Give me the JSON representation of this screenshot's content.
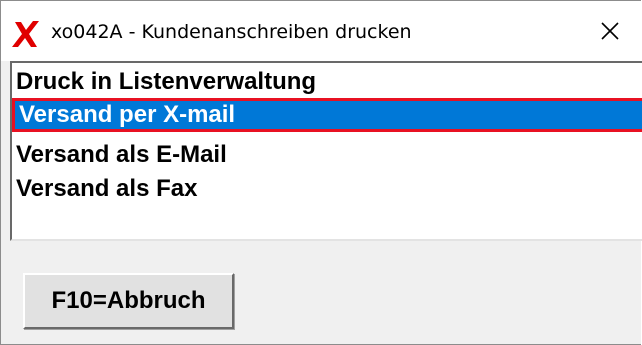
{
  "window": {
    "title": "xo042A - Kundenanschreiben drucken",
    "app_icon": "red-x-icon",
    "close_icon": "close-icon"
  },
  "list": {
    "items": [
      {
        "label": "Druck in Listenverwaltung",
        "selected": false
      },
      {
        "label": "Versand per X-mail",
        "selected": true
      },
      {
        "label": "Versand als E-Mail",
        "selected": false
      },
      {
        "label": "Versand als Fax",
        "selected": false
      }
    ]
  },
  "buttons": {
    "abort_label": "F10=Abbruch"
  },
  "colors": {
    "selection_bg": "#0078d7",
    "selection_border": "#e81123",
    "icon_red": "#e00000"
  }
}
